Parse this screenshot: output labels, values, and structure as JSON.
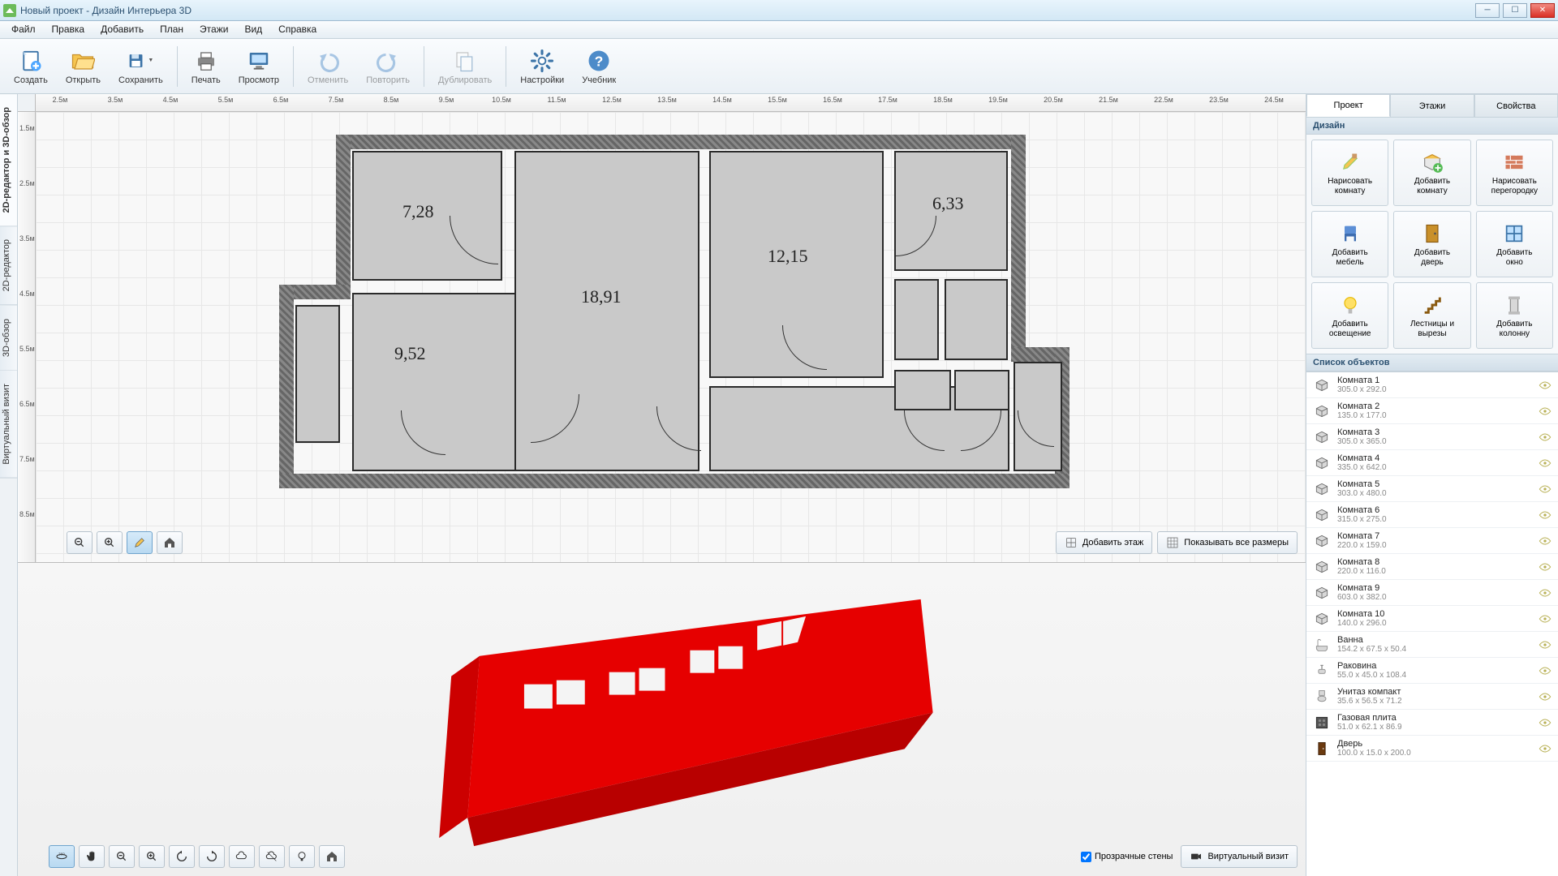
{
  "window": {
    "title": "Новый проект - Дизайн Интерьера 3D"
  },
  "menu": [
    "Файл",
    "Правка",
    "Добавить",
    "План",
    "Этажи",
    "Вид",
    "Справка"
  ],
  "toolbar": [
    {
      "id": "create",
      "label": "Создать",
      "icon": "doc-new"
    },
    {
      "id": "open",
      "label": "Открыть",
      "icon": "folder-open"
    },
    {
      "id": "save",
      "label": "Сохранить",
      "icon": "floppy",
      "dropdown": true
    },
    {
      "sep": true
    },
    {
      "id": "print",
      "label": "Печать",
      "icon": "printer"
    },
    {
      "id": "preview",
      "label": "Просмотр",
      "icon": "monitor"
    },
    {
      "sep": true
    },
    {
      "id": "undo",
      "label": "Отменить",
      "icon": "undo",
      "disabled": true
    },
    {
      "id": "redo",
      "label": "Повторить",
      "icon": "redo",
      "disabled": true
    },
    {
      "sep": true
    },
    {
      "id": "duplicate",
      "label": "Дублировать",
      "icon": "copy",
      "disabled": true
    },
    {
      "sep": true
    },
    {
      "id": "settings",
      "label": "Настройки",
      "icon": "gear"
    },
    {
      "id": "manual",
      "label": "Учебник",
      "icon": "help"
    }
  ],
  "left_tabs": [
    "2D-редактор и 3D-обзор",
    "2D-редактор",
    "3D-обзор",
    "Виртуальный визит"
  ],
  "ruler_h": [
    "2.5м",
    "3.5м",
    "4.5м",
    "5.5м",
    "6.5м",
    "7.5м",
    "8.5м",
    "9.5м",
    "10.5м",
    "11.5м",
    "12.5м",
    "13.5м",
    "14.5м",
    "15.5м",
    "16.5м",
    "17.5м",
    "18.5м",
    "19.5м",
    "20.5м",
    "21.5м",
    "22.5м",
    "23.5м",
    "24.5м"
  ],
  "ruler_v": [
    "1.5м",
    "2.5м",
    "3.5м",
    "4.5м",
    "5.5м",
    "6.5м",
    "7.5м",
    "8.5м"
  ],
  "rooms": [
    {
      "area": "7,28"
    },
    {
      "area": "18,91"
    },
    {
      "area": "12,15"
    },
    {
      "area": "6,33"
    },
    {
      "area": "9,52"
    }
  ],
  "canvas2d_buttons": {
    "add_floor": "Добавить этаж",
    "show_dims": "Показывать все размеры"
  },
  "panel3d": {
    "transparent": "Прозрачные стены",
    "virtual": "Виртуальный визит"
  },
  "side_tabs": [
    "Проект",
    "Этажи",
    "Свойства"
  ],
  "section_design": "Дизайн",
  "section_objects": "Список объектов",
  "tool_cards": [
    {
      "l1": "Нарисовать",
      "l2": "комнату",
      "icon": "brush"
    },
    {
      "l1": "Добавить",
      "l2": "комнату",
      "icon": "room-add"
    },
    {
      "l1": "Нарисовать",
      "l2": "перегородку",
      "icon": "wall"
    },
    {
      "l1": "Добавить",
      "l2": "мебель",
      "icon": "chair"
    },
    {
      "l1": "Добавить",
      "l2": "дверь",
      "icon": "door"
    },
    {
      "l1": "Добавить",
      "l2": "окно",
      "icon": "window"
    },
    {
      "l1": "Добавить",
      "l2": "освещение",
      "icon": "bulb"
    },
    {
      "l1": "Лестницы и",
      "l2": "вырезы",
      "icon": "stairs"
    },
    {
      "l1": "Добавить",
      "l2": "колонну",
      "icon": "column"
    }
  ],
  "objects": [
    {
      "name": "Комната 1",
      "dims": "305.0 x 292.0",
      "icon": "room"
    },
    {
      "name": "Комната 2",
      "dims": "135.0 x 177.0",
      "icon": "room"
    },
    {
      "name": "Комната 3",
      "dims": "305.0 x 365.0",
      "icon": "room"
    },
    {
      "name": "Комната 4",
      "dims": "335.0 x 642.0",
      "icon": "room"
    },
    {
      "name": "Комната 5",
      "dims": "303.0 x 480.0",
      "icon": "room"
    },
    {
      "name": "Комната 6",
      "dims": "315.0 x 275.0",
      "icon": "room"
    },
    {
      "name": "Комната 7",
      "dims": "220.0 x 159.0",
      "icon": "room"
    },
    {
      "name": "Комната 8",
      "dims": "220.0 x 116.0",
      "icon": "room"
    },
    {
      "name": "Комната 9",
      "dims": "603.0 x 382.0",
      "icon": "room"
    },
    {
      "name": "Комната 10",
      "dims": "140.0 x 296.0",
      "icon": "room"
    },
    {
      "name": "Ванна",
      "dims": "154.2 x 67.5 x 50.4",
      "icon": "bath"
    },
    {
      "name": "Раковина",
      "dims": "55.0 x 45.0 x 108.4",
      "icon": "sink"
    },
    {
      "name": "Унитаз компакт",
      "dims": "35.6 x 56.5 x 71.2",
      "icon": "toilet"
    },
    {
      "name": "Газовая плита",
      "dims": "51.0 x 62.1 x 86.9",
      "icon": "stove"
    },
    {
      "name": "Дверь",
      "dims": "100.0 x 15.0 x 200.0",
      "icon": "door-obj"
    }
  ]
}
